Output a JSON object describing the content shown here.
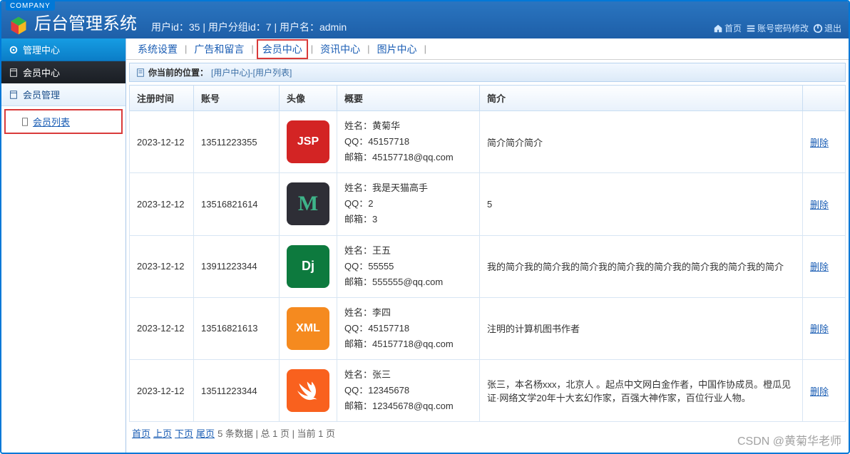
{
  "titlebar": {
    "company": "COMPANY"
  },
  "header": {
    "app_title": "后台管理系统",
    "user_info": "用户id：35 | 用户分组id：7 | 用户名：admin",
    "actions": {
      "home": "首页",
      "pwd": "账号密码修改",
      "logout": "退出"
    }
  },
  "sidebar": {
    "head": "管理中心",
    "group": "会员中心",
    "sub": "会员管理",
    "leaf": "会员列表"
  },
  "topnav": {
    "items": [
      "系统设置",
      "广告和留言",
      "会员中心",
      "资讯中心",
      "图片中心"
    ],
    "active_index": 2
  },
  "breadcrumb": {
    "label": "你当前的位置：",
    "path": "[用户中心]-[用户列表]"
  },
  "table": {
    "headers": [
      "注册时间",
      "账号",
      "头像",
      "概要",
      "简介",
      ""
    ],
    "delete_label": "删除",
    "rows": [
      {
        "reg": "2023-12-12",
        "account": "13511223355",
        "avatar": {
          "text": "JSP",
          "bg": "#d32424"
        },
        "summary": {
          "name": "黄菊华",
          "qq": "45157718",
          "email": "45157718@qq.com"
        },
        "intro": "简介简介简介"
      },
      {
        "reg": "2023-12-12",
        "account": "13516821614",
        "avatar": {
          "text": "M",
          "bg": "#2e2e36"
        },
        "summary": {
          "name": "我是天猫高手",
          "qq": "2",
          "email": "3"
        },
        "intro": "5"
      },
      {
        "reg": "2023-12-12",
        "account": "13911223344",
        "avatar": {
          "text": "Dj",
          "bg": "#0d7a3e"
        },
        "summary": {
          "name": "王五",
          "qq": "55555",
          "email": "555555@qq.com"
        },
        "intro": "我的简介我的简介我的简介我的简介我的简介我的简介我的简介我的简介"
      },
      {
        "reg": "2023-12-12",
        "account": "13516821613",
        "avatar": {
          "text": "XML",
          "bg": "#f58a1f"
        },
        "summary": {
          "name": "李四",
          "qq": "45157718",
          "email": "45157718@qq.com"
        },
        "intro": "注明的计算机图书作者"
      },
      {
        "reg": "2023-12-12",
        "account": "13511223344",
        "avatar": {
          "text": "",
          "bg": "#f9611e",
          "swift": true
        },
        "summary": {
          "name": "张三",
          "qq": "12345678",
          "email": "12345678@qq.com"
        },
        "intro": "张三，本名杨xxx，北京人 。起点中文网白金作者，中国作协成员。橙瓜见证·网络文学20年十大玄幻作家，百强大神作家，百位行业人物。"
      }
    ]
  },
  "pager": {
    "first": "首页",
    "prev": "上页",
    "next": "下页",
    "last": "尾页",
    "info": "5 条数据 | 总 1 页 | 当前 1 页"
  },
  "summary_labels": {
    "name": "姓名：",
    "qq": "QQ：",
    "email": "邮箱："
  },
  "watermark": "CSDN @黄菊华老师"
}
